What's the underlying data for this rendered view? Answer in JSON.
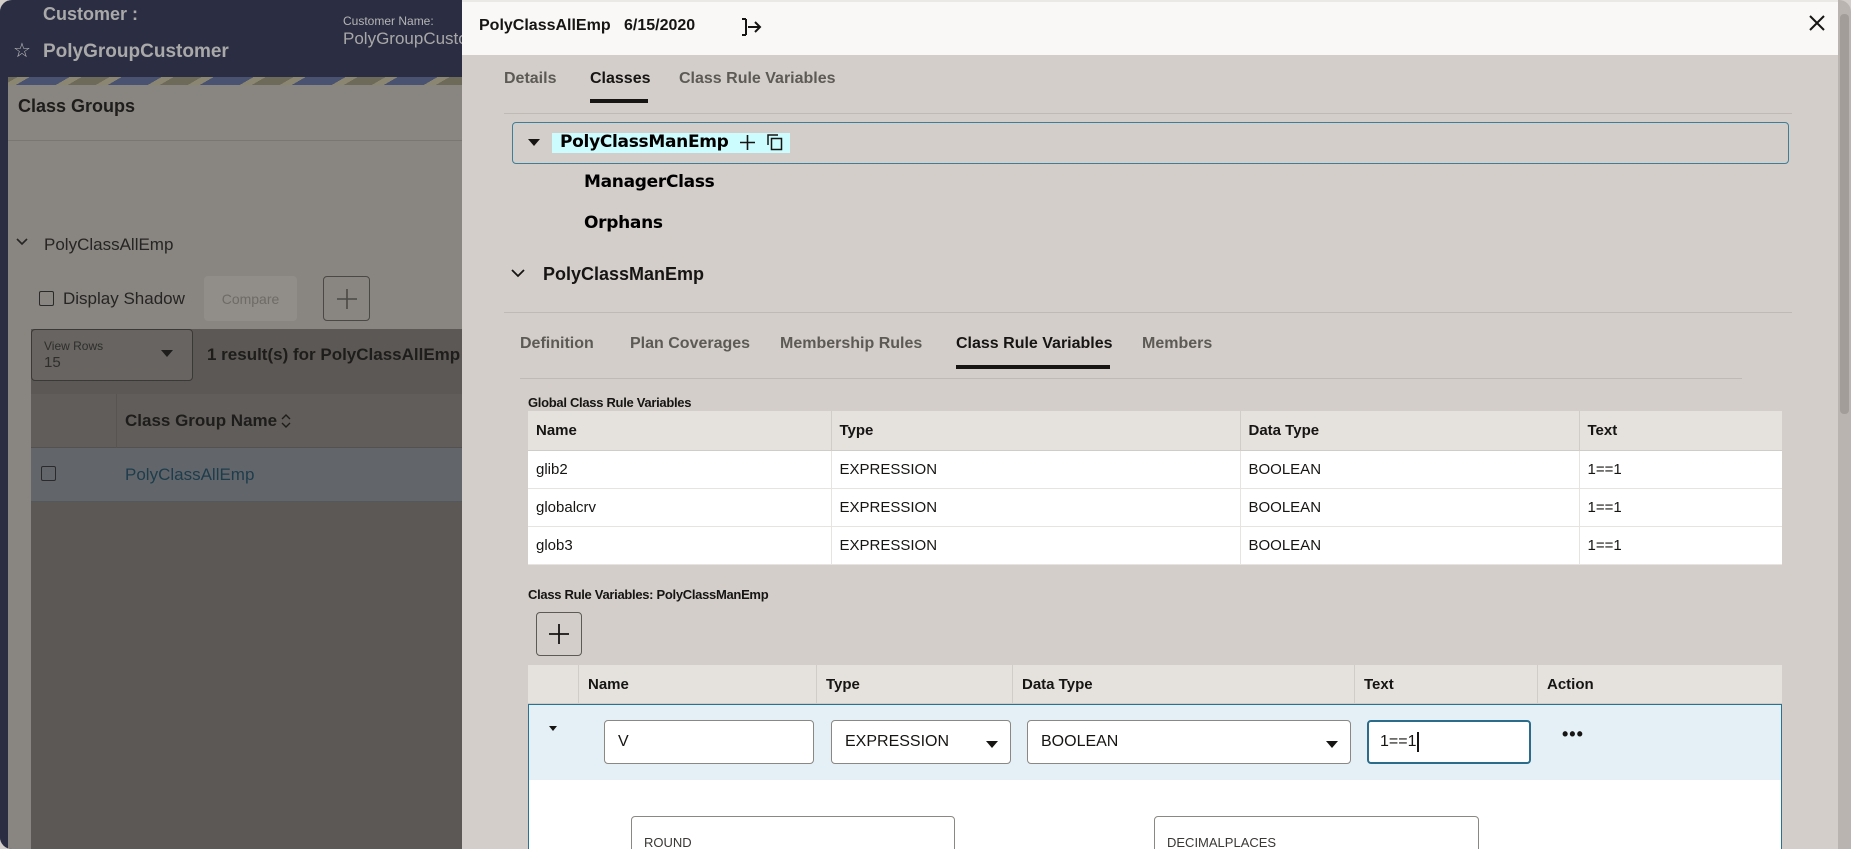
{
  "background_page": {
    "customer_heading": "Customer :",
    "customer_title": "PolyGroupCustomer",
    "customer_name_label": "Customer Name:",
    "customer_name_value": "PolyGroupCustomer",
    "panel_title": "Class Groups",
    "group_name": "PolyClassAllEmp",
    "display_shadow_label": "Display Shadow",
    "display_shadow_checked": false,
    "compare_label": "Compare",
    "view_rows_label": "View Rows",
    "view_rows_value": "15",
    "results_text": "1 result(s) for PolyClassAllEmp",
    "table": {
      "columns": [
        "Class Group Name"
      ],
      "rows": [
        {
          "name": "PolyClassAllEmp",
          "checked": false
        }
      ]
    }
  },
  "drawer": {
    "title": "PolyClassAllEmp",
    "date": "6/15/2020",
    "tabs": [
      {
        "label": "Details",
        "active": false
      },
      {
        "label": "Classes",
        "active": true
      },
      {
        "label": "Class Rule Variables",
        "active": false
      }
    ],
    "tree": {
      "root": "PolyClassManEmp",
      "children": [
        "ManagerClass",
        "Orphans"
      ]
    },
    "selected_class": "PolyClassManEmp",
    "sub_tabs": [
      {
        "label": "Definition",
        "active": false
      },
      {
        "label": "Plan Coverages",
        "active": false
      },
      {
        "label": "Membership Rules",
        "active": false
      },
      {
        "label": "Class Rule Variables",
        "active": true
      },
      {
        "label": "Members",
        "active": false
      }
    ],
    "global_vars": {
      "label": "Global Class Rule Variables",
      "columns": [
        "Name",
        "Type",
        "Data Type",
        "Text"
      ],
      "rows": [
        [
          "glib2",
          "EXPRESSION",
          "BOOLEAN",
          "1==1"
        ],
        [
          "globalcrv",
          "EXPRESSION",
          "BOOLEAN",
          "1==1"
        ],
        [
          "glob3",
          "EXPRESSION",
          "BOOLEAN",
          "1==1"
        ]
      ]
    },
    "class_vars": {
      "label": "Class Rule Variables: PolyClassManEmp",
      "columns": [
        "Name",
        "Type",
        "Data Type",
        "Text",
        "Action"
      ],
      "edit_row": {
        "name": "V",
        "type": "EXPRESSION",
        "data_type": "BOOLEAN",
        "text": "1==1",
        "action": "•••"
      },
      "detail_fields": [
        "ROUND",
        "DECIMALPLACES"
      ]
    }
  }
}
